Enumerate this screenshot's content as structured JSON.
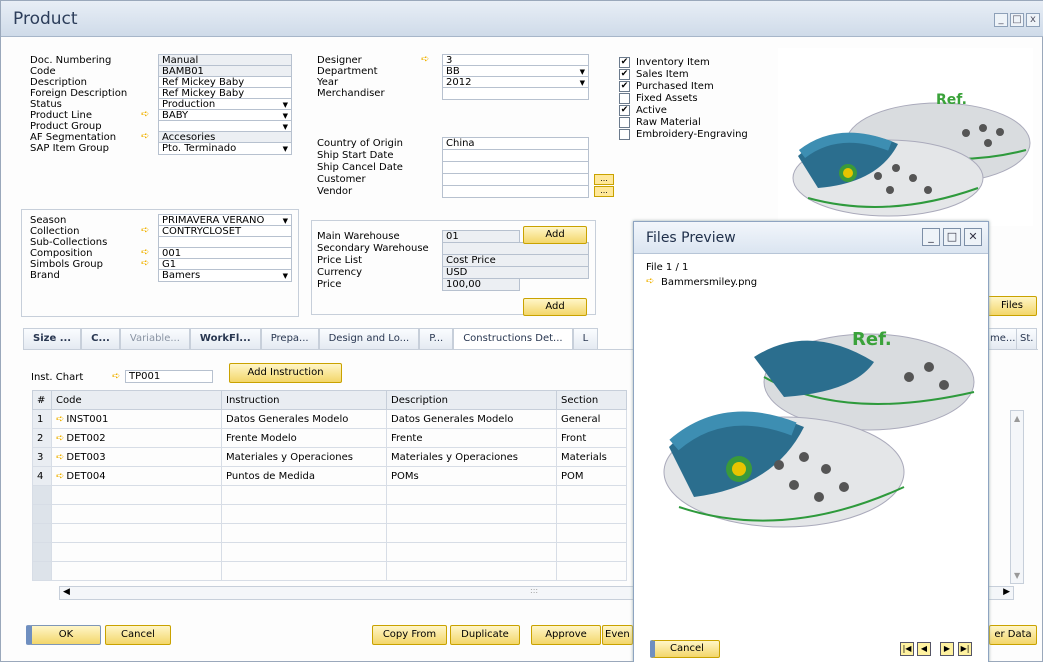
{
  "window": {
    "title": "Product",
    "min_label": "_",
    "max_label": "□",
    "close_label": "x"
  },
  "left_fields": [
    {
      "label": "Doc. Numbering",
      "value": "Manual",
      "gray": true,
      "dd": false,
      "arrow": false
    },
    {
      "label": "Code",
      "value": "BAMB01",
      "gray": true,
      "dd": false,
      "arrow": false
    },
    {
      "label": "Description",
      "value": "Ref Mickey Baby",
      "gray": false,
      "dd": false,
      "arrow": false
    },
    {
      "label": "Foreign Description",
      "value": "Ref Mickey Baby",
      "gray": false,
      "dd": false,
      "arrow": false
    },
    {
      "label": "Status",
      "value": "Production",
      "gray": false,
      "dd": true,
      "arrow": false
    },
    {
      "label": "Product Line",
      "value": "BABY",
      "gray": false,
      "dd": true,
      "arrow": true
    },
    {
      "label": "Product Group",
      "value": "",
      "gray": false,
      "dd": true,
      "arrow": false
    },
    {
      "label": "AF Segmentation",
      "value": "Accesories",
      "gray": true,
      "dd": false,
      "arrow": true
    },
    {
      "label": "SAP Item Group",
      "value": "Pto. Terminado",
      "gray": false,
      "dd": true,
      "arrow": false
    }
  ],
  "left_fields2": [
    {
      "label": "Season",
      "value": "PRIMAVERA VERANO",
      "gray": false,
      "dd": true,
      "arrow": false
    },
    {
      "label": "Collection",
      "value": "CONTRYCLOSET",
      "gray": false,
      "dd": false,
      "arrow": true
    },
    {
      "label": "Sub-Collections",
      "value": "",
      "gray": false,
      "dd": false,
      "arrow": false
    },
    {
      "label": "Composition",
      "value": "001",
      "gray": false,
      "dd": false,
      "arrow": true
    },
    {
      "label": "Simbols Group",
      "value": "G1",
      "gray": false,
      "dd": false,
      "arrow": true
    },
    {
      "label": "Brand",
      "value": "Bamers",
      "gray": false,
      "dd": true,
      "arrow": false
    }
  ],
  "mid_fields": [
    {
      "label": "Designer",
      "value": "3",
      "arrow": true,
      "dd": false,
      "gray": false
    },
    {
      "label": "Department",
      "value": "BB",
      "arrow": false,
      "dd": true,
      "gray": false
    },
    {
      "label": "Year",
      "value": "2012",
      "arrow": false,
      "dd": true,
      "gray": false
    },
    {
      "label": "Merchandiser",
      "value": "",
      "arrow": false,
      "dd": false,
      "gray": false
    }
  ],
  "mid_fields2": [
    {
      "label": "Country of Origin",
      "value": "China",
      "btn": false
    },
    {
      "label": "Ship Start Date",
      "value": "",
      "btn": false
    },
    {
      "label": "Ship Cancel Date",
      "value": "",
      "btn": false
    },
    {
      "label": "Customer",
      "value": "",
      "btn": true
    },
    {
      "label": "Vendor",
      "value": "",
      "btn": true
    }
  ],
  "mid_fields3": [
    {
      "label": "Main Warehouse",
      "value": "01",
      "gray": true
    },
    {
      "label": "Secondary Warehouse",
      "value": "",
      "gray": true
    },
    {
      "label": "Price List",
      "value": "Cost Price",
      "gray": true
    },
    {
      "label": "Currency",
      "value": "USD",
      "gray": true
    },
    {
      "label": "Price",
      "value": "100,00",
      "gray": true
    }
  ],
  "add_label": "Add",
  "ellipsis": "...",
  "checkboxes": [
    {
      "label": "Inventory Item",
      "checked": true
    },
    {
      "label": "Sales Item",
      "checked": true
    },
    {
      "label": "Purchased Item",
      "checked": true
    },
    {
      "label": "Fixed Assets",
      "checked": false
    },
    {
      "label": "Active",
      "checked": true
    },
    {
      "label": "Raw Material",
      "checked": false
    },
    {
      "label": "Embroidery-Engraving",
      "checked": false
    }
  ],
  "image_text": "Ref.",
  "files_button": "Files",
  "tabs": [
    {
      "label": "Size ...",
      "style": "bold"
    },
    {
      "label": "C...",
      "style": "bold"
    },
    {
      "label": "Variable...",
      "style": "dim"
    },
    {
      "label": "WorkFl...",
      "style": "bold"
    },
    {
      "label": "Prepa...",
      "style": "norm"
    },
    {
      "label": "Design and Lo...",
      "style": "norm"
    },
    {
      "label": "P...",
      "style": "norm"
    },
    {
      "label": "Constructions Det...",
      "style": "active"
    },
    {
      "label": "L",
      "style": "norm"
    }
  ],
  "tabs_right": [
    "me...",
    "St."
  ],
  "inst_chart": {
    "label": "Inst. Chart",
    "value": "TP001",
    "button": "Add Instruction"
  },
  "table": {
    "headers": [
      "#",
      "Code",
      "Instruction",
      "Description",
      "Section"
    ],
    "rows": [
      {
        "n": "1",
        "code": "INST001",
        "instruction": "Datos Generales Modelo",
        "description": "Datos Generales Modelo",
        "section": "General"
      },
      {
        "n": "2",
        "code": "DET002",
        "instruction": "Frente Modelo",
        "description": "Frente",
        "section": "Front"
      },
      {
        "n": "3",
        "code": "DET003",
        "instruction": "Materiales y Operaciones",
        "description": "Materiales y Operaciones",
        "section": "Materials"
      },
      {
        "n": "4",
        "code": "DET004",
        "instruction": "Puntos de Medida",
        "description": "POMs",
        "section": "POM"
      }
    ],
    "empty_rows": 5
  },
  "bottom_buttons": {
    "ok": "OK",
    "cancel": "Cancel",
    "copy_from": "Copy From",
    "duplicate": "Duplicate",
    "approve": "Approve",
    "events": "Even",
    "user_data": "er Data"
  },
  "preview": {
    "title": "Files Preview",
    "file_counter": "File 1 / 1",
    "file_name": "Bammersmiley.png",
    "image_text": "Ref.",
    "cancel": "Cancel",
    "nav": [
      "|◀",
      "◀",
      "▶",
      "▶|"
    ]
  }
}
